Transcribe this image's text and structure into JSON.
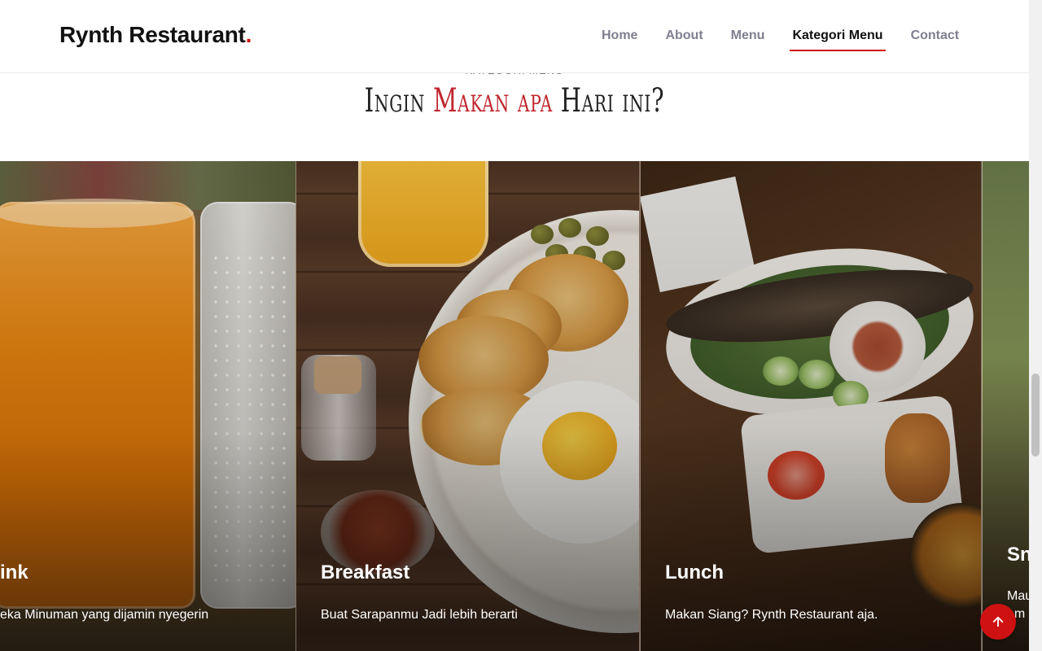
{
  "header": {
    "logo_text": "Rynth Restaurant",
    "logo_dot": ".",
    "nav": [
      {
        "label": "Home",
        "active": false
      },
      {
        "label": "About",
        "active": false
      },
      {
        "label": "Menu",
        "active": false
      },
      {
        "label": "Kategori Menu",
        "active": true
      },
      {
        "label": "Contact",
        "active": false
      }
    ]
  },
  "section": {
    "kicker": "KATEGORI MENU",
    "title_part1": "Ingin ",
    "title_accent": "Makan apa",
    "title_part2": " Hari ini?"
  },
  "cards": [
    {
      "title": "ink",
      "desc": "eka Minuman yang dijamin nyegerin"
    },
    {
      "title": "Breakfast",
      "desc": "Buat Sarapanmu Jadi lebih berarti"
    },
    {
      "title": "Lunch",
      "desc": "Makan Siang? Rynth Restaurant aja."
    },
    {
      "title": "Sn",
      "desc": "Mau\nam"
    }
  ],
  "back_to_top_icon": "arrow-up-icon",
  "colors": {
    "accent": "#ce1212",
    "nav_text": "#7f7f90",
    "nav_active": "#111111"
  }
}
